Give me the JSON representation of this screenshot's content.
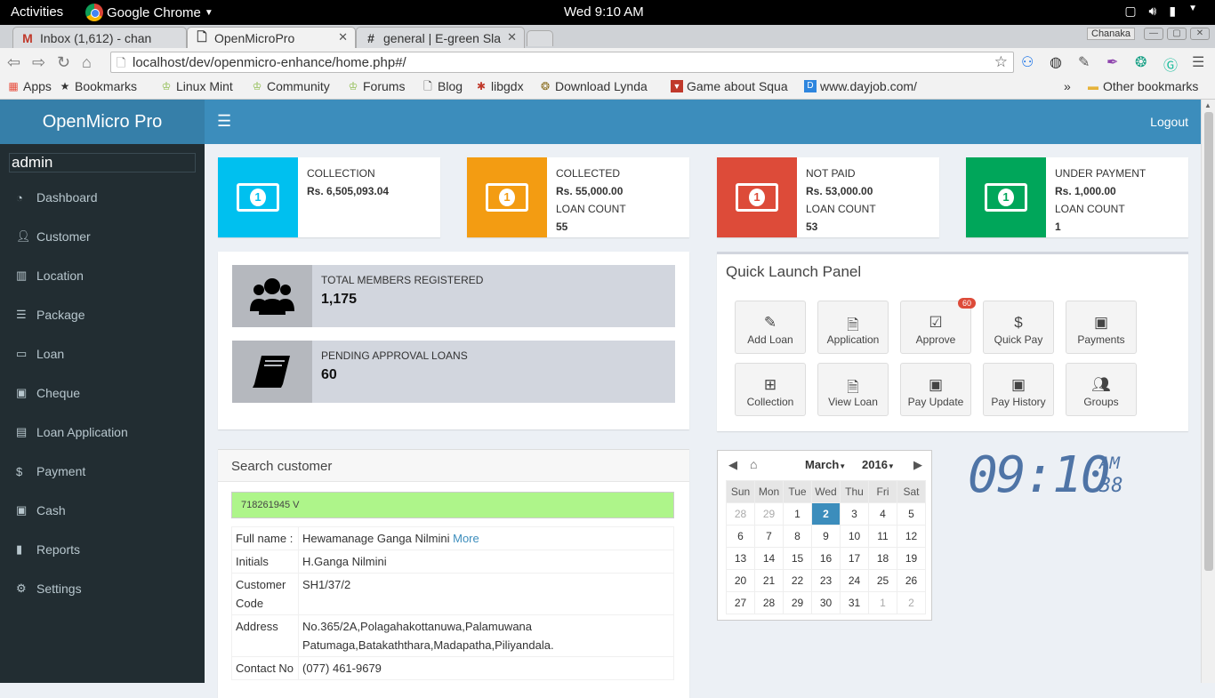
{
  "os": {
    "activities": "Activities",
    "app_name": "Google Chrome",
    "clock": "Wed  9:10 AM"
  },
  "browser": {
    "tabs": [
      {
        "label": "Inbox (1,612) - chan",
        "icon": "M"
      },
      {
        "label": "OpenMicroPro",
        "icon": ""
      },
      {
        "label": "general | E-green Sla",
        "icon": "#"
      }
    ],
    "user": "Chanaka",
    "url": "localhost/dev/openmicro-enhance/home.php#/",
    "bookmarks": [
      "Apps",
      "Bookmarks",
      "Linux Mint",
      "Community",
      "Forums",
      "Blog",
      "libgdx",
      "Download Lynda",
      "Game about Squa",
      "www.dayjob.com/"
    ],
    "more": "»",
    "other_bookmarks": "Other bookmarks"
  },
  "sidebar": {
    "logo": "OpenMicro Pro",
    "user": "admin",
    "items": [
      {
        "label": "Dashboard",
        "icon": "dashboard-icon"
      },
      {
        "label": "Customer",
        "icon": "user-icon"
      },
      {
        "label": "Location",
        "icon": "map-icon"
      },
      {
        "label": "Package",
        "icon": "list-icon"
      },
      {
        "label": "Loan",
        "icon": "loan-icon"
      },
      {
        "label": "Cheque",
        "icon": "money-icon"
      },
      {
        "label": "Loan Application",
        "icon": "book-icon"
      },
      {
        "label": "Payment",
        "icon": "dollar-icon"
      },
      {
        "label": "Cash",
        "icon": "money-icon"
      },
      {
        "label": "Reports",
        "icon": "bar-chart-icon"
      },
      {
        "label": "Settings",
        "icon": "cogs-icon"
      }
    ]
  },
  "header": {
    "logout": "Logout"
  },
  "infoboxes": [
    {
      "label": "COLLECTION",
      "amount": "Rs. 6,505,093.04",
      "count_label": "",
      "count": "",
      "color": "#00c0ef"
    },
    {
      "label": "COLLECTED",
      "amount": "Rs. 55,000.00",
      "count_label": "LOAN COUNT",
      "count": "55",
      "color": "#f39c12"
    },
    {
      "label": "NOT PAID",
      "amount": "Rs. 53,000.00",
      "count_label": "LOAN COUNT",
      "count": "53",
      "color": "#dd4b39"
    },
    {
      "label": "UNDER PAYMENT",
      "amount": "Rs. 1,000.00",
      "count_label": "LOAN COUNT",
      "count": "1",
      "color": "#00a65a"
    }
  ],
  "stats": [
    {
      "label": "TOTAL MEMBERS REGISTERED",
      "value": "1,175"
    },
    {
      "label": "PENDING APPROVAL LOANS",
      "value": "60"
    }
  ],
  "quick_launch": {
    "title": "Quick Launch Panel",
    "buttons": [
      {
        "label": "Add Loan",
        "icon": "edit-icon",
        "badge": ""
      },
      {
        "label": "Application",
        "icon": "file-icon",
        "badge": ""
      },
      {
        "label": "Approve",
        "icon": "check-icon",
        "badge": "60"
      },
      {
        "label": "Quick Pay",
        "icon": "dollar-icon",
        "badge": ""
      },
      {
        "label": "Payments",
        "icon": "money-icon",
        "badge": ""
      },
      {
        "label": "Collection",
        "icon": "plus-icon",
        "badge": ""
      },
      {
        "label": "View Loan",
        "icon": "file-icon",
        "badge": ""
      },
      {
        "label": "Pay Update",
        "icon": "money-icon",
        "badge": ""
      },
      {
        "label": "Pay History",
        "icon": "money-icon",
        "badge": ""
      },
      {
        "label": "Groups",
        "icon": "users-icon",
        "badge": ""
      }
    ]
  },
  "search": {
    "title": "Search customer",
    "value": "718261945 V",
    "rows": [
      {
        "key": "Full name :",
        "value": "Hewamanage Ganga Nilmini",
        "link": "More"
      },
      {
        "key": "Initials",
        "value": "H.Ganga Nilmini",
        "link": ""
      },
      {
        "key": "Customer Code",
        "value": "SH1/37/2",
        "link": ""
      },
      {
        "key": "Address",
        "value": "No.365/2A,Polagahakottanuwa,Palamuwana Patumaga,Batakaththara,Madapatha,Piliyandala.",
        "link": ""
      },
      {
        "key": "Contact No",
        "value": "(077) 461-9679",
        "link": ""
      }
    ]
  },
  "calendar": {
    "month": "March",
    "year": "2016",
    "weekdays": [
      "Sun",
      "Mon",
      "Tue",
      "Wed",
      "Thu",
      "Fri",
      "Sat"
    ],
    "weeks": [
      [
        "28",
        "29",
        "1",
        "2",
        "3",
        "4",
        "5"
      ],
      [
        "6",
        "7",
        "8",
        "9",
        "10",
        "11",
        "12"
      ],
      [
        "13",
        "14",
        "15",
        "16",
        "17",
        "18",
        "19"
      ],
      [
        "20",
        "21",
        "22",
        "23",
        "24",
        "25",
        "26"
      ],
      [
        "27",
        "28",
        "29",
        "30",
        "31",
        "1",
        "2"
      ]
    ],
    "today": "2"
  },
  "digital_clock": {
    "time": "09:10",
    "ampm": "AM",
    "seconds": "38"
  }
}
